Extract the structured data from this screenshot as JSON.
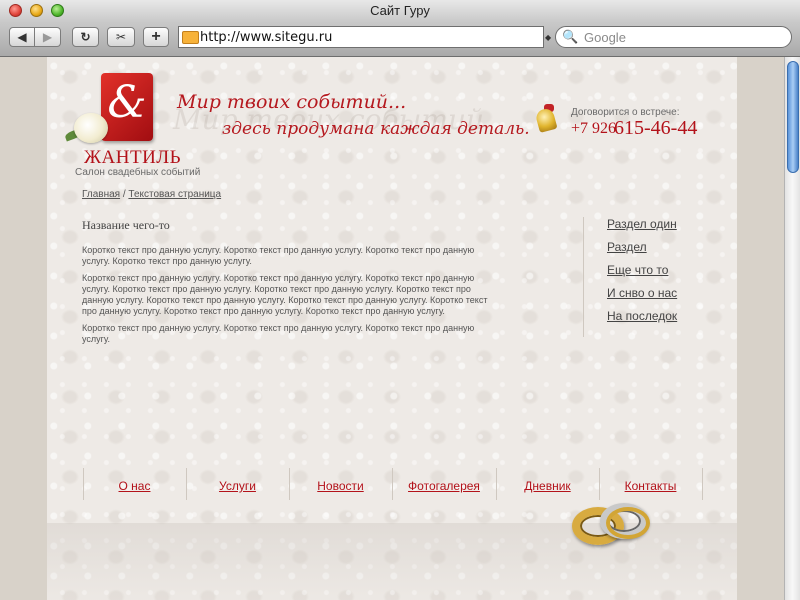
{
  "window": {
    "title": "Сайт Гуру"
  },
  "toolbar": {
    "back": "◀",
    "forward": "▶",
    "reload": "↻",
    "snap": "✂",
    "add": "+",
    "url": "http://www.sitegu.ru",
    "search_placeholder": "Google",
    "search_icon": "🔍"
  },
  "header": {
    "logo_glyph": "&",
    "brand_name": "ЖАНТИЛЬ",
    "brand_sub": "Салон свадебных событий",
    "tagline_1": "Мир твоих событий...",
    "tagline_2": "здесь продумана каждая деталь.",
    "tagline_ghost": "Мир твоих событий",
    "appt_label": "Договорится о встрече:",
    "phone_prefix": "+7 926",
    "phone_number": "615-46-44"
  },
  "breadcrumb": {
    "home": "Главная",
    "sep": " / ",
    "current": "Текстовая страница"
  },
  "content": {
    "heading": "Название чего-то",
    "paragraphs": [
      "Коротко текст про данную услугу.  Коротко текст про данную услугу. Коротко текст про данную услугу.  Коротко текст про данную услугу.",
      "Коротко текст про данную услугу.  Коротко текст про данную услугу. Коротко текст про данную услугу.  Коротко текст про данную услугу. Коротко текст про данную услугу. Коротко текст про данную услугу.  Коротко текст про данную услугу. Коротко текст про данную услугу. Коротко текст про данную услугу.  Коротко текст про данную услугу. Коротко текст про данную услугу.",
      "Коротко текст про данную услугу.  Коротко текст про данную услугу. Коротко текст про данную услугу."
    ]
  },
  "side_nav": [
    "Раздел один",
    "Раздел",
    "Еще что то",
    "И снво о нас",
    "На последок"
  ],
  "footer_nav": [
    "О нас",
    "Услуги",
    "Новости",
    "Фотогалерея",
    "Дневник",
    "Контакты"
  ],
  "colors": {
    "accent": "#b3121a",
    "page_bg": "#eeeae6",
    "scroll_thumb": "#5b94d9"
  }
}
